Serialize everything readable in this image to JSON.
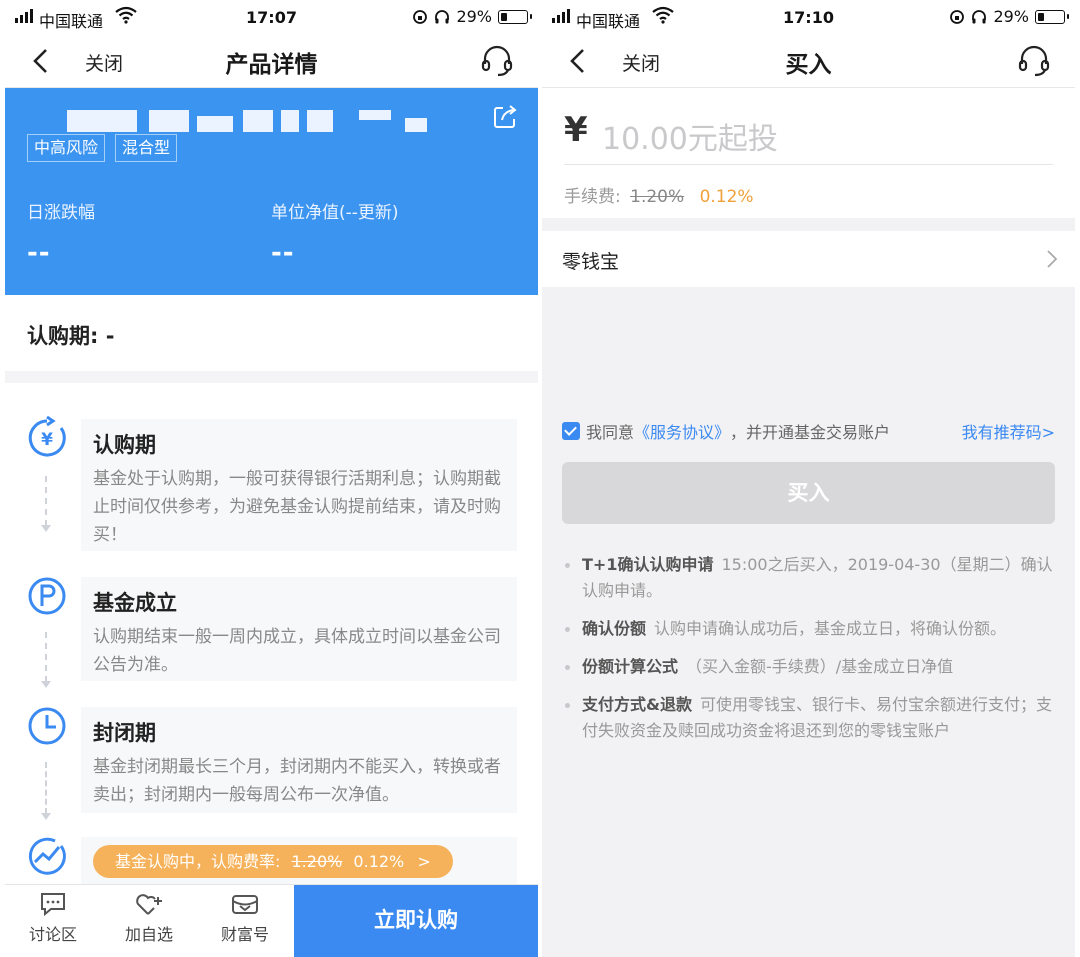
{
  "left": {
    "status": {
      "carrier": "中国联通",
      "time": "17:07",
      "battery": "29%"
    },
    "nav": {
      "close": "关闭",
      "title": "产品详情"
    },
    "hero": {
      "tags": [
        "中高风险",
        "混合型"
      ],
      "daily_change_label": "日涨跌幅",
      "daily_change_value": "--",
      "nav_label": "单位净值(--更新)",
      "nav_value": "--"
    },
    "subscription_period": "认购期: -",
    "steps": [
      {
        "title": "认购期",
        "desc": "基金处于认购期，一般可获得银行活期利息；认购期截止时间仅供参考，为避免基金认购提前结束，请及时购买！",
        "icon": "yen-cycle-icon"
      },
      {
        "title": "基金成立",
        "desc": "认购期结束一般一周内成立，具体成立时间以基金公司公告为准。",
        "icon": "p-circle-icon"
      },
      {
        "title": "封闭期",
        "desc": "基金封闭期最长三个月，封闭期内不能买入，转换或者卖出；封闭期内一般每周公布一次净值。",
        "icon": "clock-icon"
      }
    ],
    "promo": {
      "text": "基金认购中，认购费率:",
      "old_rate": "1.20%",
      "new_rate": "0.12%",
      "arrow": ">"
    },
    "tabs": [
      {
        "label": "讨论区",
        "icon": "chat-icon"
      },
      {
        "label": "加自选",
        "icon": "heart-plus-icon"
      },
      {
        "label": "财富号",
        "icon": "wealth-icon"
      }
    ],
    "buy_now": "立即认购"
  },
  "right": {
    "status": {
      "carrier": "中国联通",
      "time": "17:10",
      "battery": "29%"
    },
    "nav": {
      "close": "关闭",
      "title": "买入"
    },
    "amount": {
      "currency": "¥",
      "placeholder": "10.00元起投"
    },
    "fee": {
      "label": "手续费:",
      "old_rate": "1.20%",
      "new_rate": "0.12%"
    },
    "payment_method": "零钱宝",
    "agreement": {
      "prefix": "我同意",
      "link": "《服务协议》",
      "suffix": "，并开通基金交易账户"
    },
    "referral": "我有推荐码>",
    "buy_button": "买入",
    "notes": [
      {
        "title": "T+1确认认购申请",
        "text": "15:00之后买入，2019-04-30（星期二）确认认购申请。"
      },
      {
        "title": "确认份额",
        "text": "认购申请确认成功后，基金成立日，将确认份额。"
      },
      {
        "title": "份额计算公式",
        "text": "（买入金额-手续费）/基金成立日净值"
      },
      {
        "title": "支付方式&退款",
        "text": "可使用零钱宝、银行卡、易付宝余额进行支付；支付失败资金及赎回成功资金将退还到您的零钱宝账户"
      }
    ]
  },
  "colors": {
    "primary_blue": "#3b94f0",
    "button_blue": "#3b8af2",
    "promo_orange": "#f6b25a",
    "fee_orange": "#f0a13a"
  }
}
